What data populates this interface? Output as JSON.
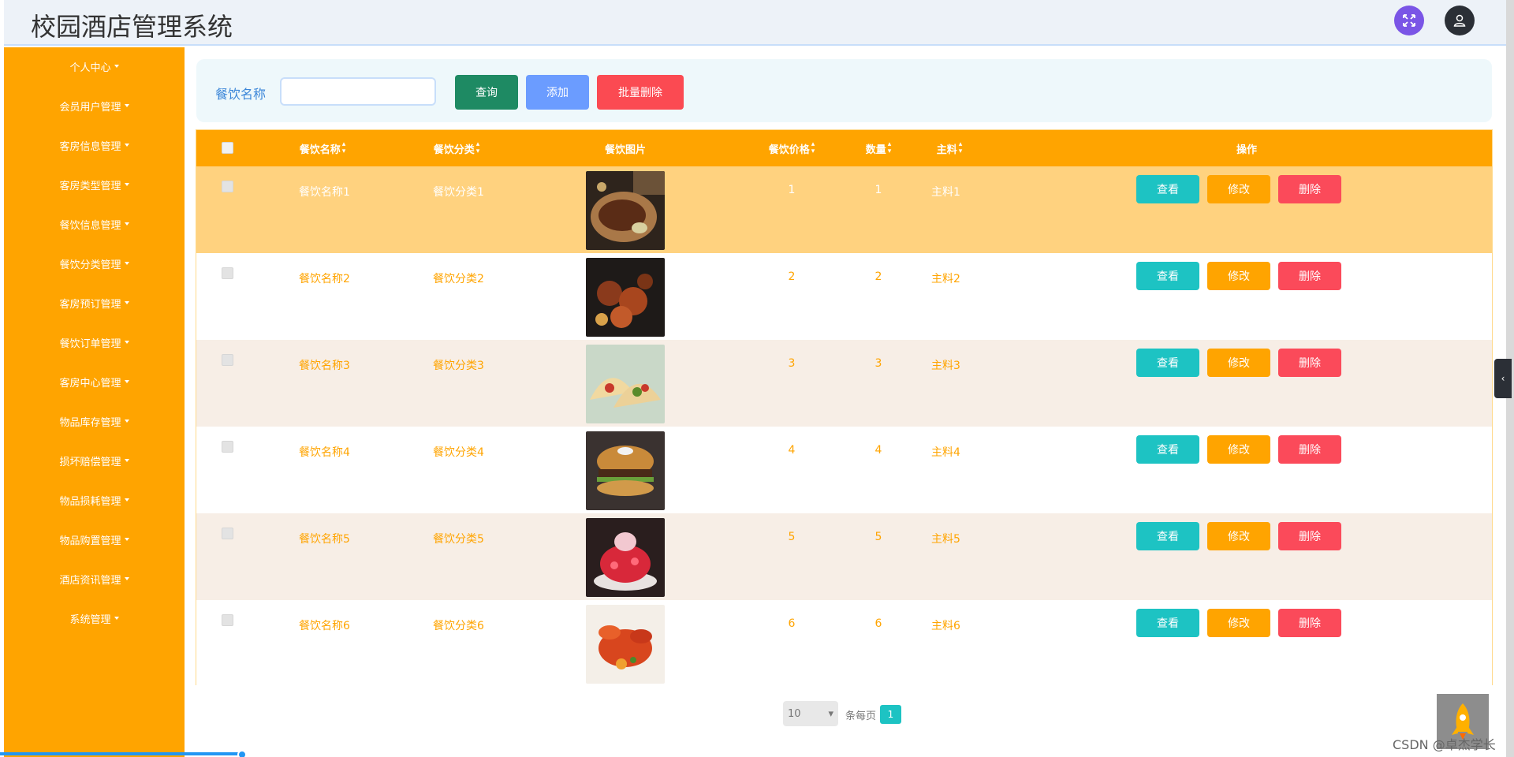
{
  "header": {
    "title": "校园酒店管理系统"
  },
  "sidebar": {
    "items": [
      {
        "label": "个人中心"
      },
      {
        "label": "会员用户管理"
      },
      {
        "label": "客房信息管理"
      },
      {
        "label": "客房类型管理"
      },
      {
        "label": "餐饮信息管理"
      },
      {
        "label": "餐饮分类管理"
      },
      {
        "label": "客房预订管理"
      },
      {
        "label": "餐饮订单管理"
      },
      {
        "label": "客房中心管理"
      },
      {
        "label": "物品库存管理"
      },
      {
        "label": "损坏赔偿管理"
      },
      {
        "label": "物品损耗管理"
      },
      {
        "label": "物品购置管理"
      },
      {
        "label": "酒店资讯管理"
      },
      {
        "label": "系统管理"
      }
    ]
  },
  "search": {
    "label": "餐饮名称",
    "value": "",
    "query_label": "查询",
    "add_label": "添加",
    "bulk_delete_label": "批量删除"
  },
  "table": {
    "headers": {
      "name": "餐饮名称",
      "category": "餐饮分类",
      "image": "餐饮图片",
      "price": "餐饮价格",
      "quantity": "数量",
      "ingredient": "主料",
      "actions": "操作"
    },
    "rows": [
      {
        "name": "餐饮名称1",
        "category": "餐饮分类1",
        "image": "steak",
        "price": "1",
        "quantity": "1",
        "ingredient": "主料1"
      },
      {
        "name": "餐饮名称2",
        "category": "餐饮分类2",
        "image": "grilled-meat",
        "price": "2",
        "quantity": "2",
        "ingredient": "主料2"
      },
      {
        "name": "餐饮名称3",
        "category": "餐饮分类3",
        "image": "tacos",
        "price": "3",
        "quantity": "3",
        "ingredient": "主料3"
      },
      {
        "name": "餐饮名称4",
        "category": "餐饮分类4",
        "image": "burger",
        "price": "4",
        "quantity": "4",
        "ingredient": "主料4"
      },
      {
        "name": "餐饮名称5",
        "category": "餐饮分类5",
        "image": "shaved-ice",
        "price": "5",
        "quantity": "5",
        "ingredient": "主料5"
      },
      {
        "name": "餐饮名称6",
        "category": "餐饮分类6",
        "image": "crab",
        "price": "6",
        "quantity": "6",
        "ingredient": "主料6"
      }
    ],
    "actions": {
      "view": "查看",
      "edit": "修改",
      "delete": "删除"
    }
  },
  "pagination": {
    "page_size": "10",
    "per_page_label": "条每页",
    "current_page": "1"
  },
  "watermark": "CSDN @卓杰学长",
  "colors": {
    "sidebar": "#ffa400",
    "table_header": "#ffa400",
    "highlight_row": "#ffd27f",
    "alt_row": "#f7eee6",
    "view_button": "#1dc3c3",
    "edit_button": "#ffa400",
    "delete_button": "#fb4a5a"
  },
  "icons": {
    "fullscreen": "expand-icon",
    "user": "user-icon",
    "back_to_top": "rocket-icon",
    "drawer": "chevron-left-icon"
  }
}
